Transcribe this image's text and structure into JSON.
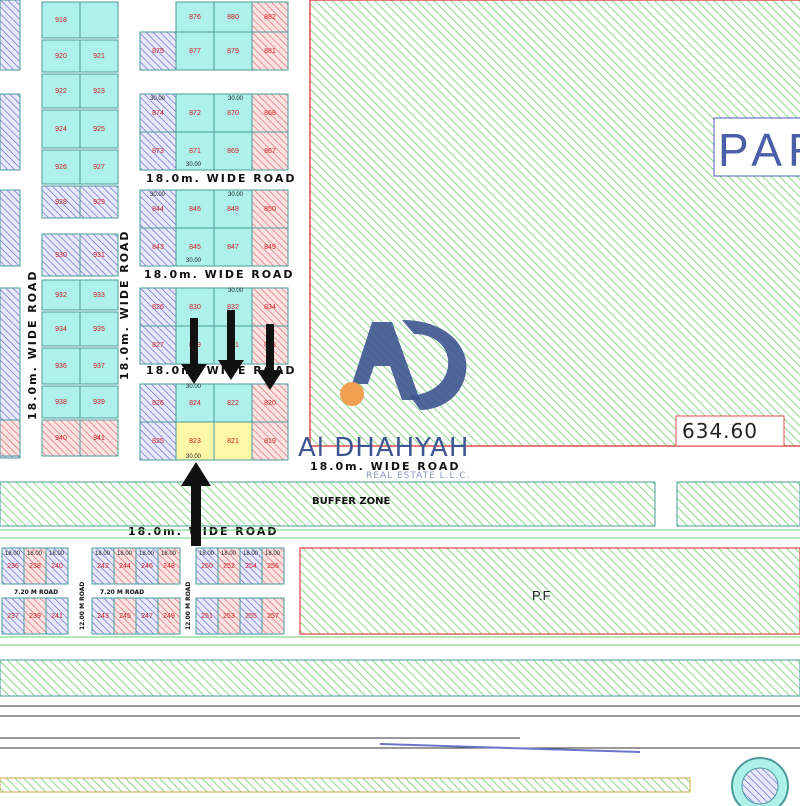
{
  "map": {
    "colors": {
      "plot_fill": "#aef0ea",
      "plot_stroke": "#4b9b9b",
      "hatch_green": "#6ccf6c",
      "hatch_red": "#e07070",
      "hatch_blue": "#6a74c8",
      "yellow_plot": "#fff7a8",
      "park_border": "#e05050",
      "brand": "#3d5590",
      "brand_accent": "#f0a050"
    },
    "labels": {
      "road_1": "18.0m. WIDE ROAD",
      "road_2": "18.0m. WIDE ROAD",
      "road_3": "18.0m. WIDE ROAD",
      "road_4": "18.0m. WIDE ROAD",
      "road_5": "18.0m. WIDE ROAD",
      "road_vertical_left": "18.0m. WIDE ROAD",
      "road_vertical_mid": "18.0m. WIDE ROAD",
      "buffer_zone": "BUFFER ZONE",
      "pf": "P.F",
      "area_value": "634.60",
      "park_partial": "PAR",
      "road_12m_a": "12.00 M ROAD",
      "road_12m_b": "12.00 M ROAD",
      "road_720_a": "7.20 M ROAD",
      "road_720_b": "7.20 M ROAD"
    },
    "watermark": {
      "name": "Al DHAHYAH",
      "subtitle": "REAL ESTATE L.L.C."
    },
    "plots": {
      "col_a": [
        "918",
        "920",
        "921",
        "922",
        "923",
        "924",
        "925",
        "926",
        "927",
        "928",
        "929",
        "930",
        "931",
        "932",
        "933",
        "934",
        "935",
        "936",
        "937",
        "938",
        "939",
        "940",
        "941"
      ],
      "block_top": [
        "876",
        "880",
        "882",
        "875",
        "877",
        "879",
        "881"
      ],
      "block_2": [
        "874",
        "872",
        "870",
        "868",
        "873",
        "871",
        "869",
        "867"
      ],
      "block_3": [
        "844",
        "846",
        "848",
        "850",
        "843",
        "845",
        "847",
        "849"
      ],
      "block_4": [
        "826",
        "830",
        "832",
        "834",
        "827",
        "829",
        "831",
        "833"
      ],
      "block_5": [
        "826",
        "824",
        "822",
        "820",
        "825",
        "823",
        "821",
        "819"
      ],
      "bottom_row_1": [
        "236",
        "238",
        "240",
        "242",
        "244",
        "246",
        "248",
        "250",
        "252",
        "254",
        "256"
      ],
      "bottom_row_2": [
        "237",
        "239",
        "241",
        "243",
        "245",
        "247",
        "249",
        "251",
        "253",
        "255",
        "257"
      ]
    },
    "dims": {
      "d30": "30.00",
      "d18": "18.00"
    }
  }
}
